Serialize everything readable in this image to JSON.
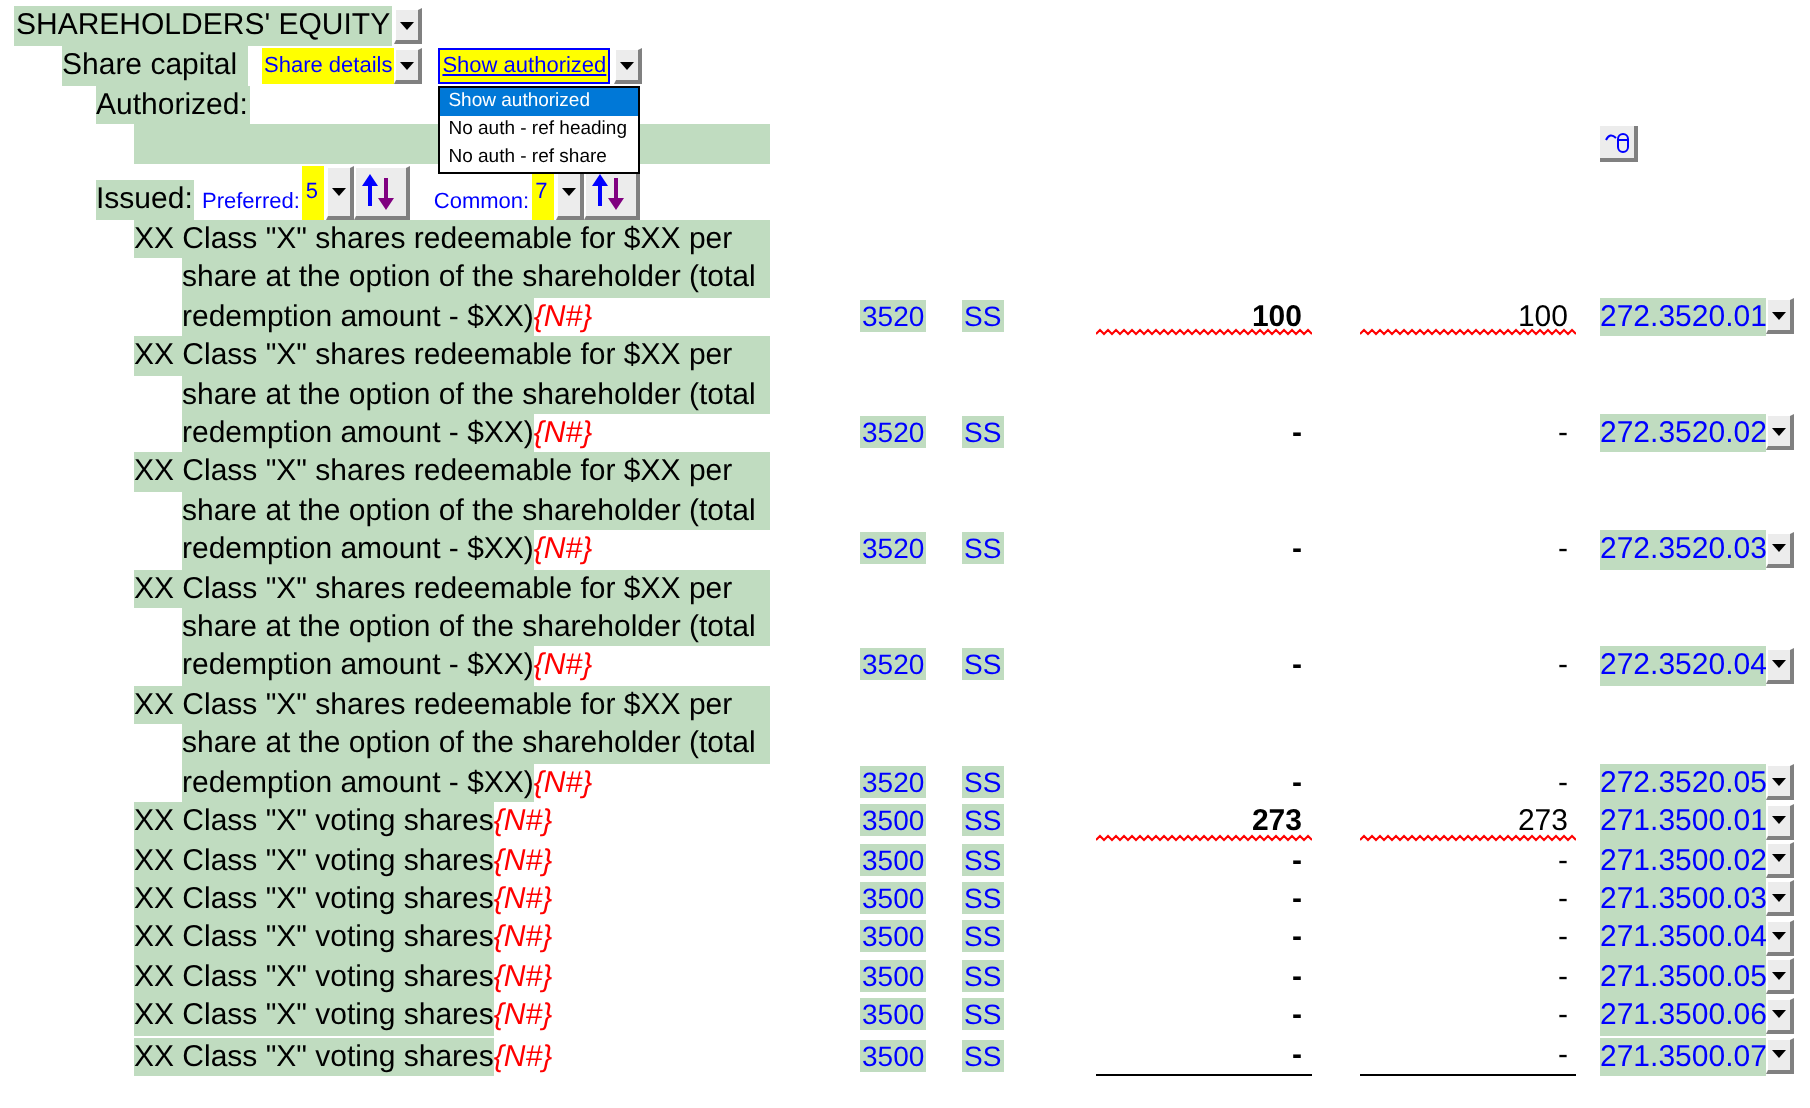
{
  "title": "SHAREHOLDERS' EQUITY",
  "share_capital": {
    "label": "Share capital",
    "details_dropdown": "Share details",
    "auth_dropdown": {
      "value": "Show authorized",
      "expanded": true,
      "options": [
        {
          "label": "Show authorized",
          "selected": true
        },
        {
          "label": "No auth - ref heading",
          "selected": false
        },
        {
          "label": "No auth - ref share",
          "selected": false
        }
      ]
    }
  },
  "authorized_label": "Authorized:",
  "issued": {
    "label": "Issued:",
    "preferred": {
      "label": "Preferred:",
      "value": "5"
    },
    "common": {
      "label": "Common:",
      "value": "7"
    }
  },
  "rows": [
    {
      "lines": [
        "XX Class \"X\" shares redeemable for $XX per",
        "share at the option of the shareholder (total",
        "redemption amount - $XX)"
      ],
      "note": "{N#}",
      "code": "3520",
      "type": "SS",
      "amount": "100",
      "prior": "100",
      "flagged": true,
      "ref": "272.3520.01"
    },
    {
      "lines": [
        "XX Class \"X\" shares redeemable for $XX per",
        "share at the option of the shareholder (total",
        "redemption amount - $XX)"
      ],
      "note": "{N#}",
      "code": "3520",
      "type": "SS",
      "amount": "-",
      "prior": "-",
      "flagged": false,
      "ref": "272.3520.02"
    },
    {
      "lines": [
        "XX Class \"X\" shares redeemable for $XX per",
        "share at the option of the shareholder (total",
        "redemption amount - $XX)"
      ],
      "note": "{N#}",
      "code": "3520",
      "type": "SS",
      "amount": "-",
      "prior": "-",
      "flagged": false,
      "ref": "272.3520.03"
    },
    {
      "lines": [
        "XX Class \"X\" shares redeemable for $XX per",
        "share at the option of the shareholder (total",
        "redemption amount - $XX)"
      ],
      "note": "{N#}",
      "code": "3520",
      "type": "SS",
      "amount": "-",
      "prior": "-",
      "flagged": false,
      "ref": "272.3520.04"
    },
    {
      "lines": [
        "XX Class \"X\" shares redeemable for $XX per",
        "share at the option of the shareholder (total",
        "redemption amount - $XX)"
      ],
      "note": "{N#}",
      "code": "3520",
      "type": "SS",
      "amount": "-",
      "prior": "-",
      "flagged": false,
      "ref": "272.3520.05"
    },
    {
      "lines": [
        "XX Class \"X\" voting shares"
      ],
      "note": "{N#}",
      "code": "3500",
      "type": "SS",
      "amount": "273",
      "prior": "273",
      "flagged": true,
      "ref": "271.3500.01"
    },
    {
      "lines": [
        "XX Class \"X\" voting shares"
      ],
      "note": "{N#}",
      "code": "3500",
      "type": "SS",
      "amount": "-",
      "prior": "-",
      "flagged": false,
      "ref": "271.3500.02"
    },
    {
      "lines": [
        "XX Class \"X\" voting shares"
      ],
      "note": "{N#}",
      "code": "3500",
      "type": "SS",
      "amount": "-",
      "prior": "-",
      "flagged": false,
      "ref": "271.3500.03"
    },
    {
      "lines": [
        "XX Class \"X\" voting shares"
      ],
      "note": "{N#}",
      "code": "3500",
      "type": "SS",
      "amount": "-",
      "prior": "-",
      "flagged": false,
      "ref": "271.3500.04"
    },
    {
      "lines": [
        "XX Class \"X\" voting shares"
      ],
      "note": "{N#}",
      "code": "3500",
      "type": "SS",
      "amount": "-",
      "prior": "-",
      "flagged": false,
      "ref": "271.3500.05"
    },
    {
      "lines": [
        "XX Class \"X\" voting shares"
      ],
      "note": "{N#}",
      "code": "3500",
      "type": "SS",
      "amount": "-",
      "prior": "-",
      "flagged": false,
      "ref": "271.3500.06"
    },
    {
      "lines": [
        "XX Class \"X\" voting shares"
      ],
      "note": "{N#}",
      "code": "3500",
      "type": "SS",
      "amount": "-",
      "prior": "-",
      "flagged": false,
      "ref": "271.3500.07"
    }
  ]
}
